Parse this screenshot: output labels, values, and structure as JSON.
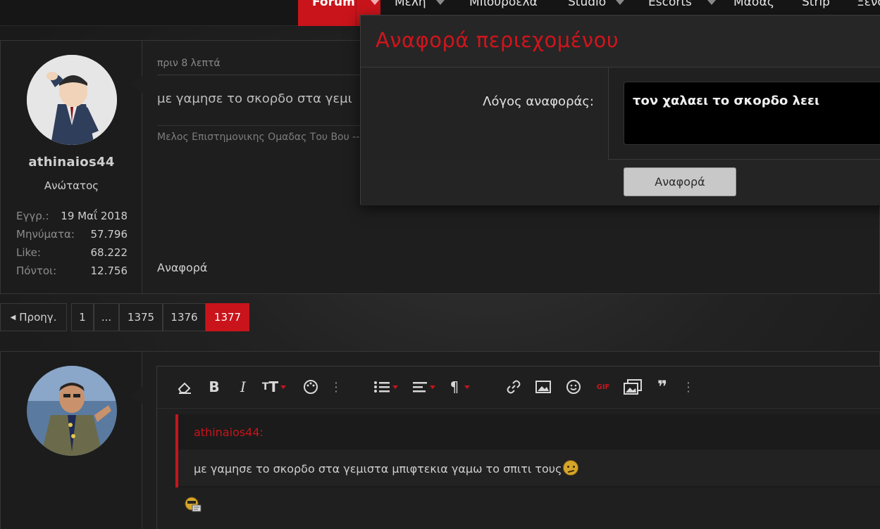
{
  "nav": {
    "items": [
      {
        "label": "Forum",
        "dropdown": true
      },
      {
        "label": "Μέλη",
        "dropdown": true
      },
      {
        "label": "Μπουρδέλα",
        "dropdown": false
      },
      {
        "label": "Studio",
        "dropdown": true
      },
      {
        "label": "Escorts",
        "dropdown": true
      },
      {
        "label": "Μασάζ",
        "dropdown": false
      },
      {
        "label": "Strip",
        "dropdown": false
      },
      {
        "label": "Ξενο",
        "dropdown": false
      }
    ]
  },
  "post": {
    "author": "athinaios44",
    "author_title": "Ανώτατος",
    "stats": [
      {
        "label": "Εγγρ.:",
        "value": "19 Μαΐ 2018"
      },
      {
        "label": "Μηνύματα:",
        "value": "57.796"
      },
      {
        "label": "Like:",
        "value": "68.222"
      },
      {
        "label": "Πόντοι:",
        "value": "12.756"
      }
    ],
    "time": "πριν 8 λεπτά",
    "body": "με γαμησε το σκορδο στα γεμι",
    "signature": "Μελος Επιστημονικης Ομαδας Του Βου --",
    "report_link": "Αναφορά"
  },
  "pagination": {
    "prev": "Προηγ.",
    "pages": [
      "1",
      "...",
      "1375",
      "1376",
      "1377"
    ],
    "current": "1377"
  },
  "editor": {
    "quote_author": "athinaios44:",
    "quote_text": "με γαμησε το σκορδο στα γεμιστα μπιφτεκια γαμω το σπιτι τους",
    "toolbar": {
      "bold": "B",
      "italic": "I",
      "text_size": "T",
      "paragraph": "¶",
      "gif": "GIF",
      "quote": "❞"
    }
  },
  "modal": {
    "title": "Αναφορά περιεχομένου",
    "reason_label": "Λόγος αναφοράς:",
    "reason_value": "τον χαλαει το σκορδο λεει",
    "submit_label": "Αναφορά"
  },
  "colors": {
    "accent": "#c9141b",
    "background": "#1b1b1b",
    "panel": "#1e1e1e"
  }
}
